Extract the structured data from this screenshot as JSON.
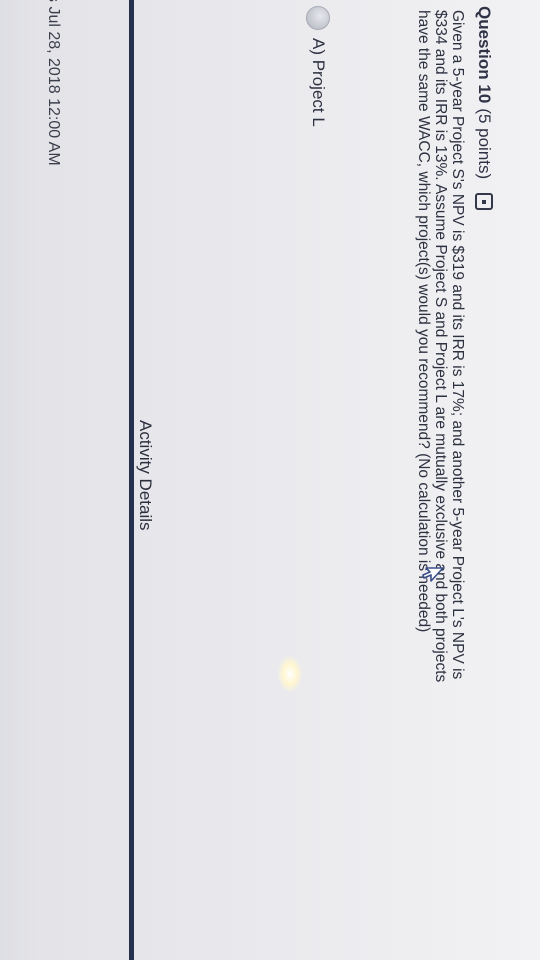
{
  "question": {
    "title": "Question 10",
    "points": "(5 points)",
    "bookmark_icon": "bookmark-icon",
    "text_lines": [
      "Given a 5-year Project S's NPV is $319 and its IRR is 17%; and another 5-year Project L's NPV is",
      "$334 and its IRR is 13%. Assume Project S and Project L are mutually exclusive and both projects",
      "have the same WACC, which project(s) would you recommend? (No calculation is needed)"
    ]
  },
  "options": [
    {
      "label": "A) Project L",
      "selected": false
    }
  ],
  "activity": {
    "title": "Activity Details",
    "due_date": "s Jul 28, 2018 12:00 AM"
  },
  "colors": {
    "divider": "#26314f",
    "text": "#2d3140"
  }
}
